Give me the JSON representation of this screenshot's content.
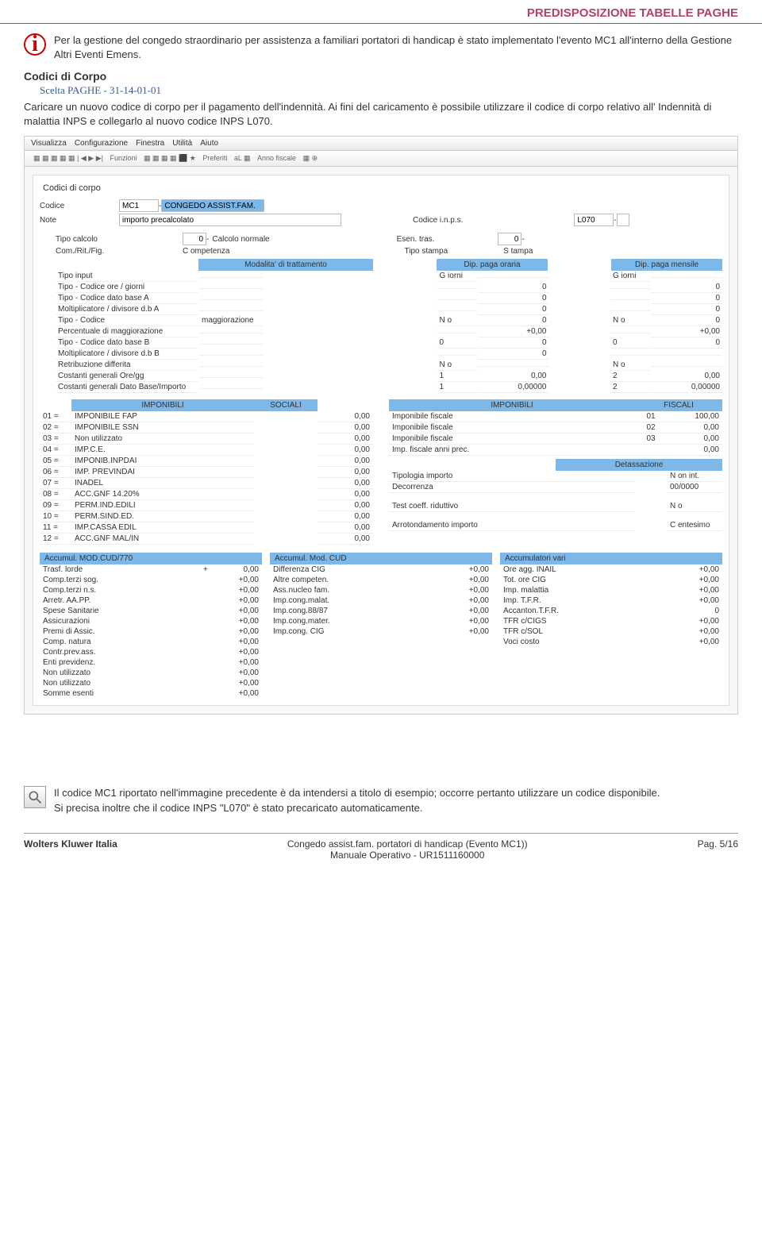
{
  "header": "PREDISPOSIZIONE TABELLE PAGHE",
  "info_text": "Per la gestione del congedo straordinario per assistenza a familiari portatori di handicap è stato implementato l'evento MC1 all'interno della Gestione Altri Eventi Emens.",
  "section": "Codici di Corpo",
  "sub": "Scelta PAGHE - 31-14-01-01",
  "para": "Caricare un nuovo codice di corpo per il pagamento dell'indennità. Ai fini del caricamento è possibile utilizzare il codice di corpo relativo all' Indennità di malattia INPS e collegarlo al nuovo codice INPS L070.",
  "app": {
    "menu": [
      "Visualizza",
      "Configurazione",
      "Finestra",
      "Utilità",
      "Aiuto"
    ],
    "toolbar_label": "Funzioni",
    "toolbar_pref": "Preferiti",
    "toolbar_fisc": "Anno fiscale",
    "panel_title": "Codici di corpo",
    "codice_label": "Codice",
    "codice_val": "MC1",
    "codice_desc": "CONGEDO ASSIST.FAM.",
    "note_label": "Note",
    "note_val": "importo precalcolato",
    "inps_label": "Codice i.n.p.s.",
    "inps_val": "L070",
    "tipo_calc": "Tipo calcolo",
    "tipo_calc_v": "0",
    "tipo_calc_d": "Calcolo normale",
    "esen": "Esen. tras.",
    "esen_v": "0",
    "com": "Com./Rit./Fig.",
    "com_v": "C ompetenza",
    "tipo_st": "Tipo stampa",
    "tipo_st_v": "S tampa",
    "hdr_mod": "Modalita' di trattamento",
    "hdr_or": "Dip. paga oraria",
    "hdr_mens": "Dip. paga mensile",
    "rows": [
      {
        "l": "Tipo input",
        "a": "",
        "b": "G iorni",
        "c": "",
        "d": "G iorni",
        "e": ""
      },
      {
        "l": "Tipo - Codice ore / giorni",
        "a": "",
        "b": "",
        "c": "0",
        "d": "",
        "e": "0"
      },
      {
        "l": "Tipo - Codice dato base A",
        "a": "",
        "b": "",
        "c": "0",
        "d": "",
        "e": "0"
      },
      {
        "l": "Moltiplicatore / divisore d.b A",
        "a": "",
        "b": "",
        "c": "0",
        "d": "",
        "e": "0"
      },
      {
        "l": "Tipo - Codice",
        "a": "maggiorazione",
        "b": "N o",
        "c": "0",
        "d": "N o",
        "e": "0"
      },
      {
        "l": "Percentuale di maggiorazione",
        "a": "",
        "b": "",
        "c": "+0,00",
        "d": "",
        "e": "+0,00"
      },
      {
        "l": "Tipo - Codice dato base B",
        "a": "",
        "b": "0",
        "c": "0",
        "d": "0",
        "e": "0"
      },
      {
        "l": "Moltiplicatore / divisore d.b B",
        "a": "",
        "b": "",
        "c": "0",
        "d": "",
        "e": ""
      },
      {
        "l": "Retribuzione differita",
        "a": "",
        "b": "N o",
        "c": "",
        "d": "N o",
        "e": ""
      },
      {
        "l": "Costanti generali Ore/gg",
        "a": "",
        "b": "1",
        "c": "0,00",
        "d": "2",
        "e": "0,00"
      },
      {
        "l": "Costanti generali Dato Base/Importo",
        "a": "",
        "b": "1",
        "c": "0,00000",
        "d": "2",
        "e": "0,00000"
      }
    ],
    "imp_h1": "IMPONIBILI",
    "imp_h2": "SOCIALI",
    "imp_h3": "IMPONIBILI",
    "imp_h4": "FISCALI",
    "imp_left": [
      {
        "n": "01 =",
        "d": "IMPONIBILE FAP",
        "v": "0,00"
      },
      {
        "n": "02 =",
        "d": "IMPONIBILE SSN",
        "v": "0,00"
      },
      {
        "n": "03 =",
        "d": "Non utilizzato",
        "v": "0,00"
      },
      {
        "n": "04 =",
        "d": "IMP.C.E.",
        "v": "0,00"
      },
      {
        "n": "05 =",
        "d": "IMPONIB.INPDAI",
        "v": "0,00"
      },
      {
        "n": "06 =",
        "d": "IMP. PREVINDAI",
        "v": "0,00"
      },
      {
        "n": "07 =",
        "d": "INADEL",
        "v": "0,00"
      },
      {
        "n": "08 =",
        "d": "ACC.GNF 14.20%",
        "v": "0,00"
      },
      {
        "n": "09 =",
        "d": "PERM.IND.EDILI",
        "v": "0,00"
      },
      {
        "n": "10 =",
        "d": "PERM.SIND.ED.",
        "v": "0,00"
      },
      {
        "n": "11 =",
        "d": "IMP.CASSA EDIL",
        "v": "0,00"
      },
      {
        "n": "12 =",
        "d": "ACC.GNF MAL/IN",
        "v": "0,00"
      }
    ],
    "imp_right": [
      {
        "d": "Imponibile fiscale",
        "n": "01",
        "v": "100,00"
      },
      {
        "d": "Imponibile fiscale",
        "n": "02",
        "v": "0,00"
      },
      {
        "d": "Imponibile fiscale",
        "n": "03",
        "v": "0,00"
      },
      {
        "d": "Imp. fiscale anni prec.",
        "n": "",
        "v": "0,00"
      }
    ],
    "detass": "Detassazione",
    "tip_imp": "Tipologia importo",
    "tip_imp_v": "N on int.",
    "decorr": "Decorrenza",
    "decorr_v": "00/0000",
    "test": "Test coeff. riduttivo",
    "test_v": "N o",
    "arrot": "Arrotondamento importo",
    "arrot_v": "C entesimo",
    "acc_h1": "Accumul. MOD.CUD/770",
    "acc_h2": "Accumul. Mod. CUD",
    "acc_h3": "Accumulatori vari",
    "acc1": [
      {
        "l": "Trasf. lorde",
        "s": "+",
        "v": "0,00"
      },
      {
        "l": "Comp.terzi sog.",
        "s": "",
        "v": "+0,00"
      },
      {
        "l": "Comp.terzi n.s.",
        "s": "",
        "v": "+0,00"
      },
      {
        "l": "Arretr. AA.PP.",
        "s": "",
        "v": "+0,00"
      },
      {
        "l": "Spese Sanitarie",
        "s": "",
        "v": "+0,00"
      },
      {
        "l": "Assicurazioni",
        "s": "",
        "v": "+0,00"
      },
      {
        "l": "Premi di Assic.",
        "s": "",
        "v": "+0,00"
      },
      {
        "l": "Comp. natura",
        "s": "",
        "v": "+0,00"
      },
      {
        "l": "Contr.prev.ass.",
        "s": "",
        "v": "+0,00"
      },
      {
        "l": "Enti previdenz.",
        "s": "",
        "v": "+0,00"
      },
      {
        "l": "Non utilizzato",
        "s": "",
        "v": "+0,00"
      },
      {
        "l": "Non utilizzato",
        "s": "",
        "v": "+0,00"
      },
      {
        "l": "Somme esenti",
        "s": "",
        "v": "+0,00"
      }
    ],
    "acc2": [
      {
        "l": "Differenza CIG",
        "v": "+0,00"
      },
      {
        "l": "Altre competen.",
        "v": "+0,00"
      },
      {
        "l": "Ass.nucleo fam.",
        "v": "+0,00"
      },
      {
        "l": "Imp.cong.malat.",
        "v": "+0,00"
      },
      {
        "l": "Imp.cong.88/87",
        "v": "+0,00"
      },
      {
        "l": "Imp.cong.mater.",
        "v": "+0,00"
      },
      {
        "l": "Imp.cong. CIG",
        "v": "+0,00"
      }
    ],
    "acc3": [
      {
        "l": "Ore agg. INAIL",
        "v": "+0,00"
      },
      {
        "l": "Tot. ore CIG",
        "v": "+0,00"
      },
      {
        "l": "Imp. malattia",
        "v": "+0,00"
      },
      {
        "l": "Imp. T.F.R.",
        "v": "+0,00"
      },
      {
        "l": "Accanton.T.F.R.",
        "v": "0"
      },
      {
        "l": "TFR c/CIGS",
        "v": "+0,00"
      },
      {
        "l": "TFR c/SOL",
        "v": "+0,00"
      },
      {
        "l": "Voci costo",
        "v": "+0,00"
      }
    ]
  },
  "note1": "Il codice MC1 riportato nell'immagine precedente è da intendersi a titolo di esempio; occorre pertanto utilizzare un codice disponibile.",
  "note2": "Si precisa inoltre che il codice INPS \"L070\" è stato precaricato automaticamente.",
  "footer": {
    "left": "Wolters Kluwer Italia",
    "c1": "Congedo assist.fam. portatori di handicap (Evento MC1))",
    "c2": "Manuale Operativo - UR1511160000",
    "right": "Pag. 5/16"
  }
}
